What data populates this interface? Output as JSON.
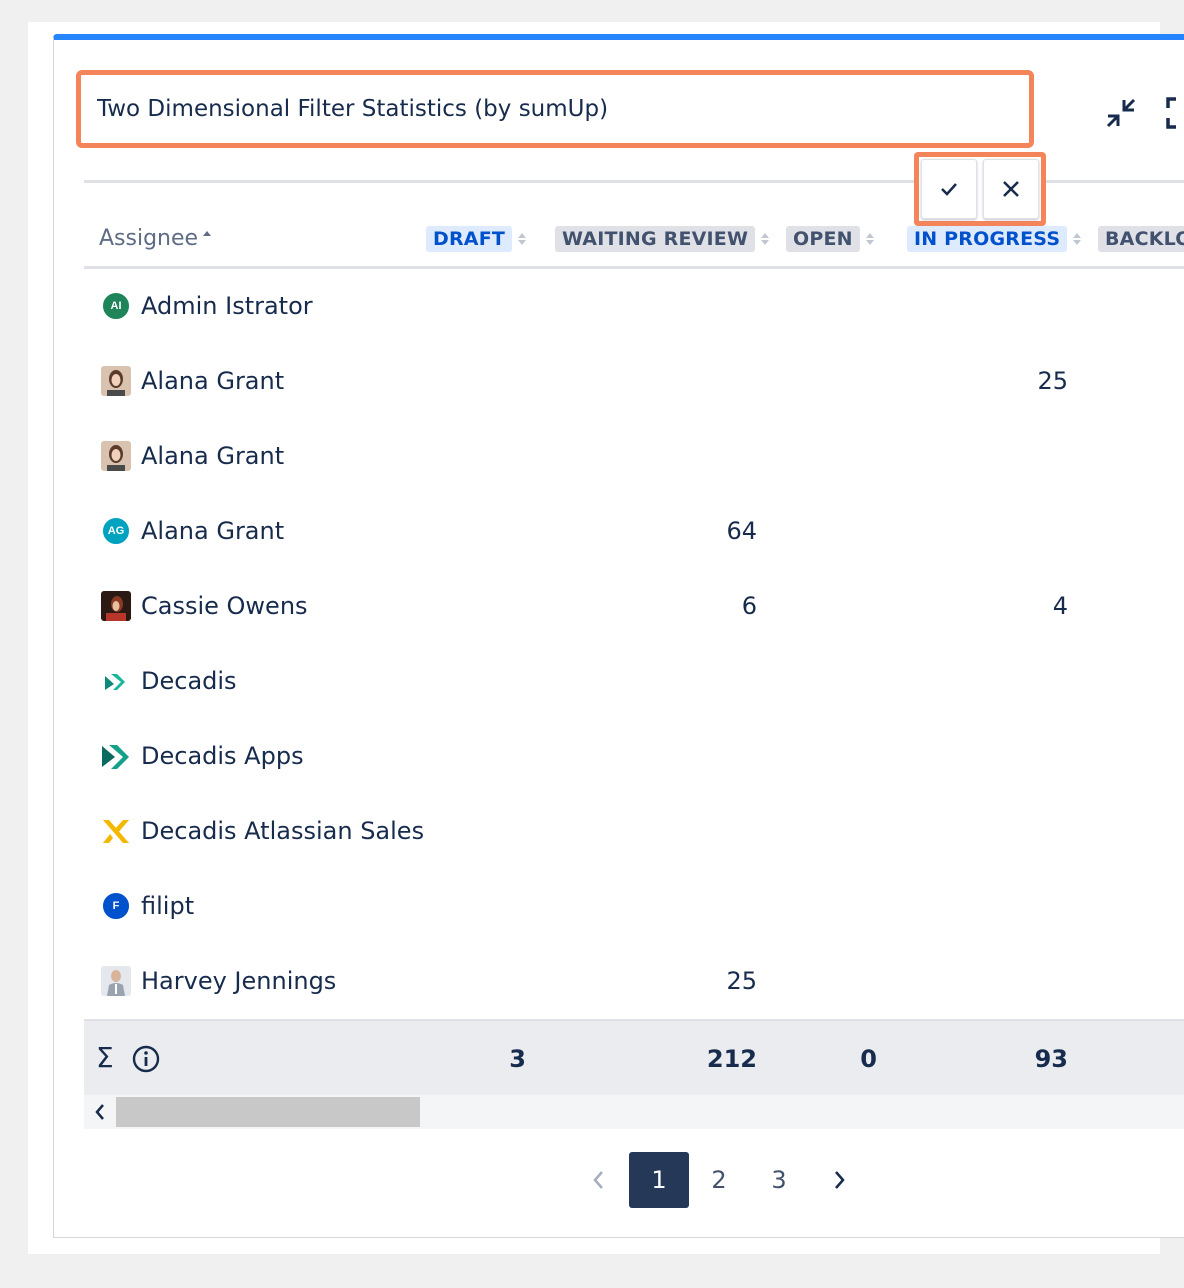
{
  "gadget": {
    "title_value": "Two Dimensional Filter Statistics (by sumUp)",
    "accent_color": "#2684ff",
    "highlight_color": "#f4845a"
  },
  "header_icons": [
    "minimize-icon",
    "fullscreen-icon"
  ],
  "edit_actions": {
    "confirm": "check-icon",
    "cancel": "close-icon"
  },
  "table": {
    "first_column_header": "Assignee",
    "columns": [
      {
        "label": "DRAFT",
        "style": "blue"
      },
      {
        "label": "WAITING REVIEW",
        "style": "grey"
      },
      {
        "label": "OPEN",
        "style": "grey"
      },
      {
        "label": "IN PROGRESS",
        "style": "blue"
      },
      {
        "label": "BACKLO",
        "style": "grey"
      }
    ],
    "rows": [
      {
        "name": "Admin Istrator",
        "avatar": "AI",
        "avatar_color": "#1f845a",
        "values": [
          "",
          "",
          "",
          ""
        ]
      },
      {
        "name": "Alana Grant",
        "avatar": "photo-woman",
        "avatar_color": "#8a6d5a",
        "values": [
          "",
          "",
          "",
          "25"
        ]
      },
      {
        "name": "Alana Grant",
        "avatar": "photo-woman",
        "avatar_color": "#8a6d5a",
        "values": [
          "",
          "",
          "",
          ""
        ]
      },
      {
        "name": "Alana Grant",
        "avatar": "AG",
        "avatar_color": "#00a3bf",
        "values": [
          "",
          "64",
          "",
          ""
        ]
      },
      {
        "name": "Cassie Owens",
        "avatar": "photo-dark",
        "avatar_color": "#5a2d20",
        "values": [
          "",
          "6",
          "",
          "4"
        ]
      },
      {
        "name": "Decadis",
        "avatar": "logo-teal-small",
        "avatar_color": "#0d8a7a",
        "values": [
          "",
          "",
          "",
          ""
        ]
      },
      {
        "name": "Decadis Apps",
        "avatar": "logo-teal",
        "avatar_color": "#0d8a7a",
        "values": [
          "",
          "",
          "",
          ""
        ]
      },
      {
        "name": "Decadis Atlassian Sales",
        "avatar": "logo-yellow",
        "avatar_color": "#f5b800",
        "values": [
          "",
          "",
          "",
          ""
        ]
      },
      {
        "name": "filipt",
        "avatar": "F",
        "avatar_color": "#0052cc",
        "values": [
          "",
          "",
          "",
          ""
        ]
      },
      {
        "name": "Harvey Jennings",
        "avatar": "photo-man",
        "avatar_color": "#9aa4b0",
        "values": [
          "",
          "25",
          "",
          ""
        ]
      }
    ],
    "totals": {
      "sigma": "Σ",
      "values": [
        "3",
        "212",
        "0",
        "93"
      ]
    }
  },
  "pagination": {
    "prev": "‹",
    "pages": [
      "1",
      "2",
      "3"
    ],
    "current": "1",
    "next": "›"
  }
}
